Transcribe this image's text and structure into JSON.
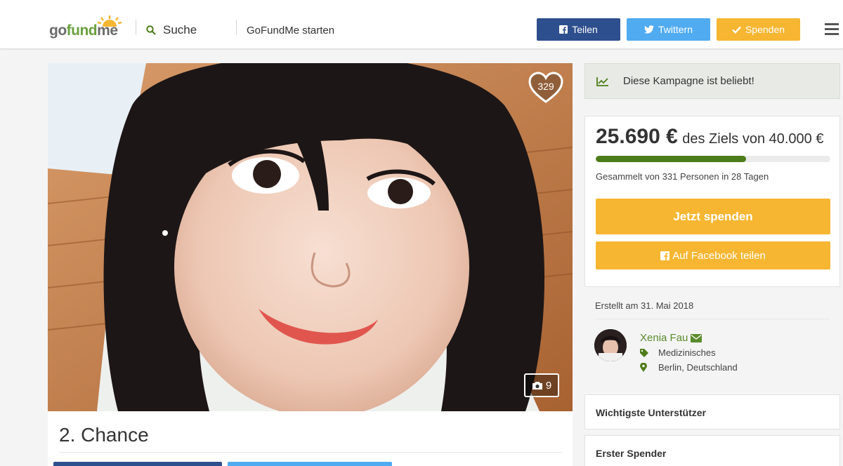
{
  "header": {
    "logo": {
      "part1": "go",
      "part2": "fund",
      "part3": "me"
    },
    "search_label": "Suche",
    "start_label": "GoFundMe starten",
    "share_label": "Teilen",
    "tweet_label": "Twittern",
    "donate_label": "Spenden"
  },
  "campaign": {
    "title": "2. Chance",
    "likes": "329",
    "photo_count": "9"
  },
  "sidebar": {
    "popular_text": "Diese Kampagne ist beliebt!",
    "amount_raised": "25.690 €",
    "goal_text": "des Ziels von 40.000 €",
    "progress_fraction": 0.64,
    "collected_text": "Gesammelt von 331 Personen in 28 Tagen",
    "donate_now_label": "Jetzt spenden",
    "facebook_share_label": "Auf Facebook teilen",
    "created_text": "Erstellt am 31. Mai 2018",
    "organizer_name": "Xenia Fau",
    "category": "Medizinisches",
    "location": "Berlin, Deutschland",
    "top_supporters_label": "Wichtigste Unterstützer",
    "first_donor_label": "Erster Spender"
  },
  "colors": {
    "facebook": "#2e4f8d",
    "twitter": "#50abf1",
    "accent_orange": "#f6b631",
    "progress_green": "#4d7c1a",
    "link_green": "#5a8b2c"
  },
  "icons": [
    "search-icon",
    "facebook-icon",
    "twitter-icon",
    "check-icon",
    "menu-icon",
    "heart-icon",
    "camera-icon",
    "trend-icon",
    "envelope-icon",
    "tag-icon",
    "map-pin-icon"
  ]
}
